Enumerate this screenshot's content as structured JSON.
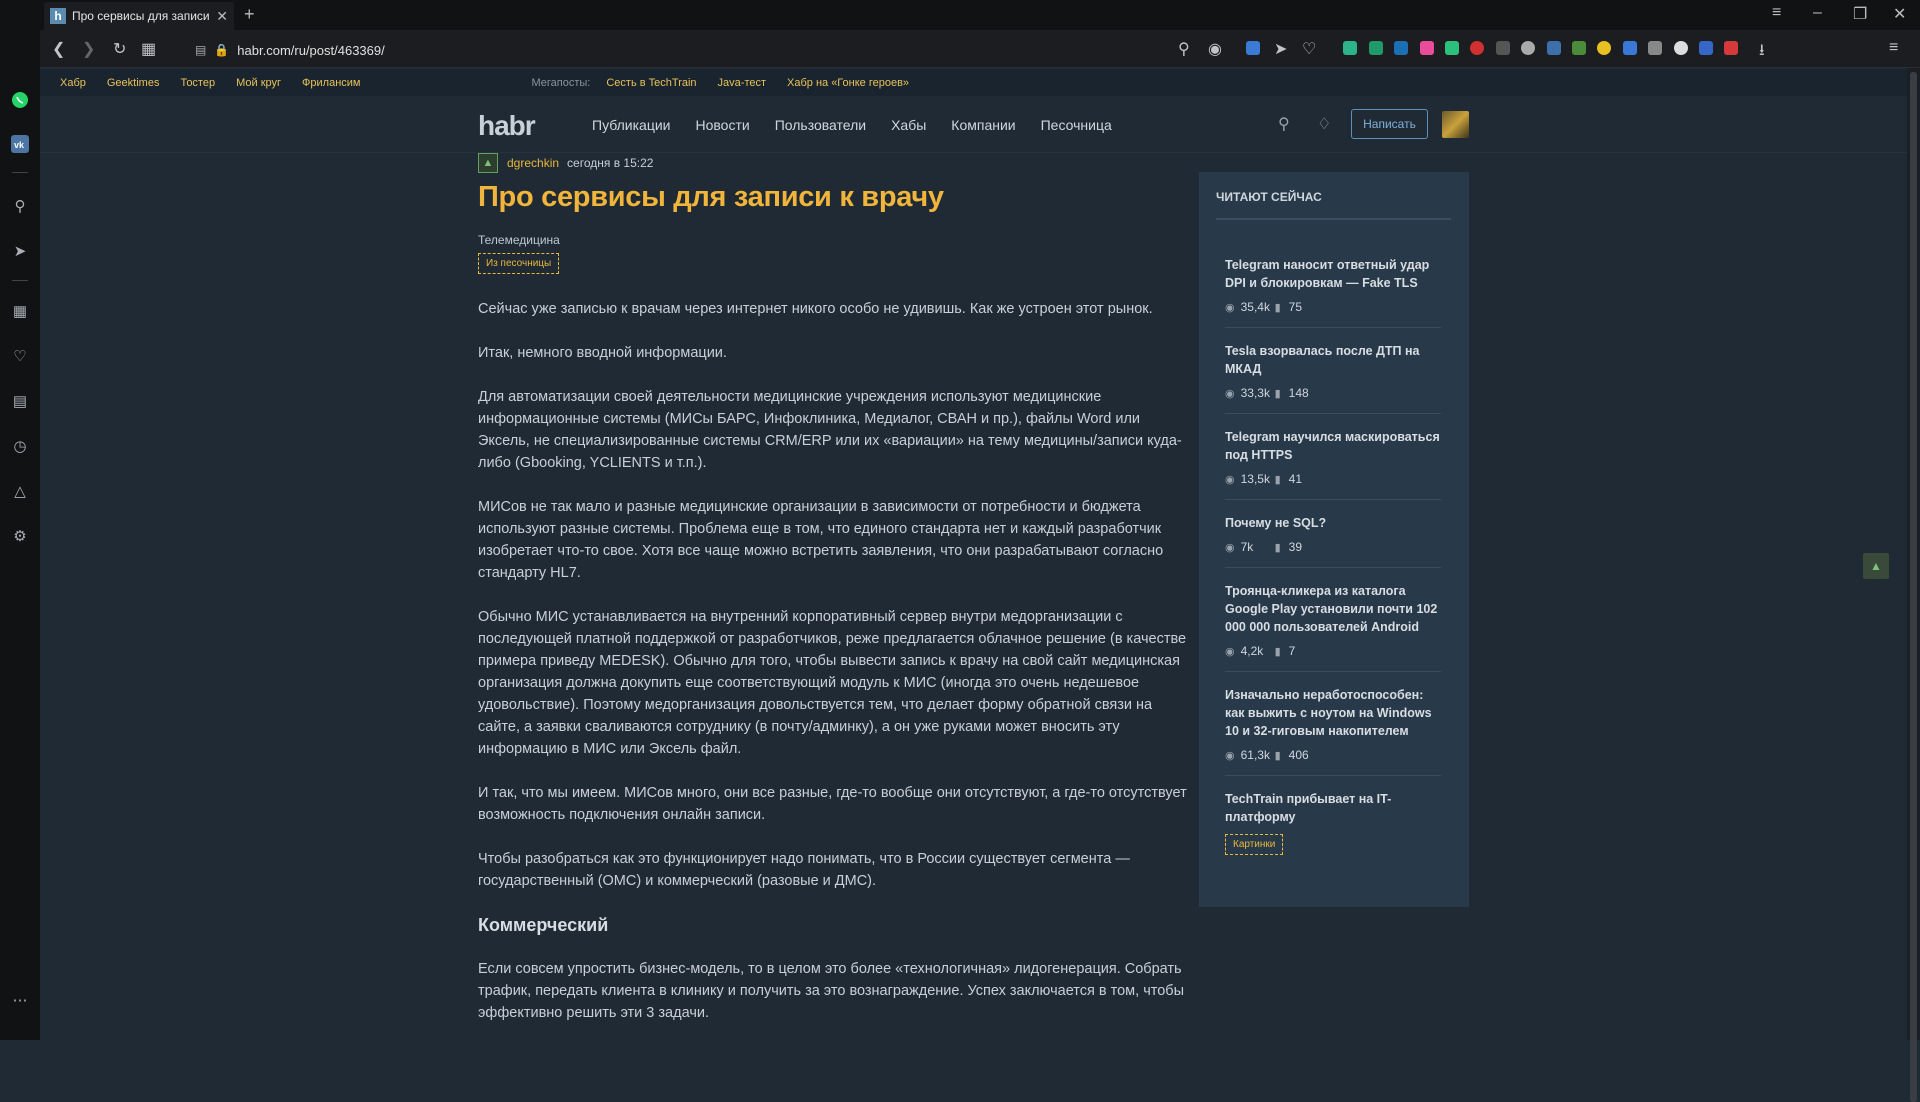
{
  "browser": {
    "tab_title": "Про сервисы для записи к врачу",
    "url": "habr.com/ru/post/463369/"
  },
  "site": {
    "topline": [
      "Хабр",
      "Geektimes",
      "Тостер",
      "Мой круг",
      "Фрилансим"
    ],
    "megaposts_label": "Мегапосты:",
    "megaposts": [
      "Сесть в TechTrain",
      "Java-тест",
      "Хабр на «Гонке героев»"
    ],
    "logo": "habr",
    "nav": [
      "Публикации",
      "Новости",
      "Пользователи",
      "Хабы",
      "Компании",
      "Песочница"
    ],
    "write_button": "Написать"
  },
  "article": {
    "author": "dgrechkin",
    "time": "сегодня в 15:22",
    "title": "Про сервисы для записи к врачу",
    "hub": "Телемедицина",
    "badge": "Из песочницы",
    "paragraphs": [
      "Сейчас уже записью к врачам через интернет никого особо не удивишь. Как же устроен этот рынок.",
      "Итак, немного вводной информации.",
      "Для автоматизации своей деятельности медицинские учреждения используют медицинские информационные системы (МИСы БАРС, Инфоклиника, Медиалог, СВАН и пр.), файлы Word или Эксель, не специализированные системы CRM/ERP или их «вариации» на тему медицины/записи куда-либо (Gbooking, YCLIENTS и т.п.).",
      "МИСов не так мало и разные медицинские организации в зависимости от потребности и бюджета используют разные системы. Проблема еще в том, что единого стандарта нет и каждый разработчик изобретает что-то свое. Хотя все чаще можно встретить заявления, что они разрабатывают согласно стандарту HL7.",
      "Обычно МИС устанавливается на внутренний корпоративный сервер внутри медорганизации с последующей платной поддержкой от разработчиков, реже предлагается облачное решение (в качестве примера приведу MEDESK). Обычно для того, чтобы вывести запись к врачу на свой сайт медицинская организация должна докупить еще соответствующий модуль к МИС (иногда это очень недешевое удовольствие). Поэтому медорганизация довольствуется тем, что делает форму обратной связи на сайте, а заявки сваливаются сотруднику (в почту/админку), а он уже руками может вносить эту информацию в МИС или Эксель файл.",
      "И так, что мы имеем. МИСов много, они все разные, где-то вообще они отсутствуют, а где-то отсутствует возможность подключения онлайн записи.",
      "Чтобы разобраться как это функционирует надо понимать, что в России существует сегмента — государственный (ОМС) и коммерческий (разовые и ДМС)."
    ],
    "subheading": "Коммерческий",
    "last_paragraph": "Если совсем упростить бизнес-модель, то в целом это более «технологичная» лидогенерация. Собрать трафик, передать клиента в клинику и получить за это вознаграждение. Успех заключается в том, чтобы эффективно решить эти 3 задачи."
  },
  "widget": {
    "title": "ЧИТАЮТ СЕЙЧАС",
    "items": [
      {
        "title": "Telegram наносит ответный удар DPI и блокировкам — Fake TLS",
        "views": "35,4k",
        "comments": "75"
      },
      {
        "title": "Tesla взорвалась после ДТП на МКАД",
        "views": "33,3k",
        "comments": "148"
      },
      {
        "title": "Telegram научился маскироваться под HTTPS",
        "views": "13,5k",
        "comments": "41"
      },
      {
        "title": "Почему не SQL?",
        "views": "7k",
        "comments": "39"
      },
      {
        "title": "Троянца-кликера из каталога Google Play установили почти 102 000 000 пользователей Android",
        "views": "4,2k",
        "comments": "7"
      },
      {
        "title": "Изначально неработоспособен: как выжить с ноутом на Windows 10 и 32-гиговым накопителем",
        "views": "61,3k",
        "comments": "406"
      },
      {
        "title": "TechTrain прибывает на IT-платформу",
        "badge": "Картинки"
      }
    ]
  }
}
